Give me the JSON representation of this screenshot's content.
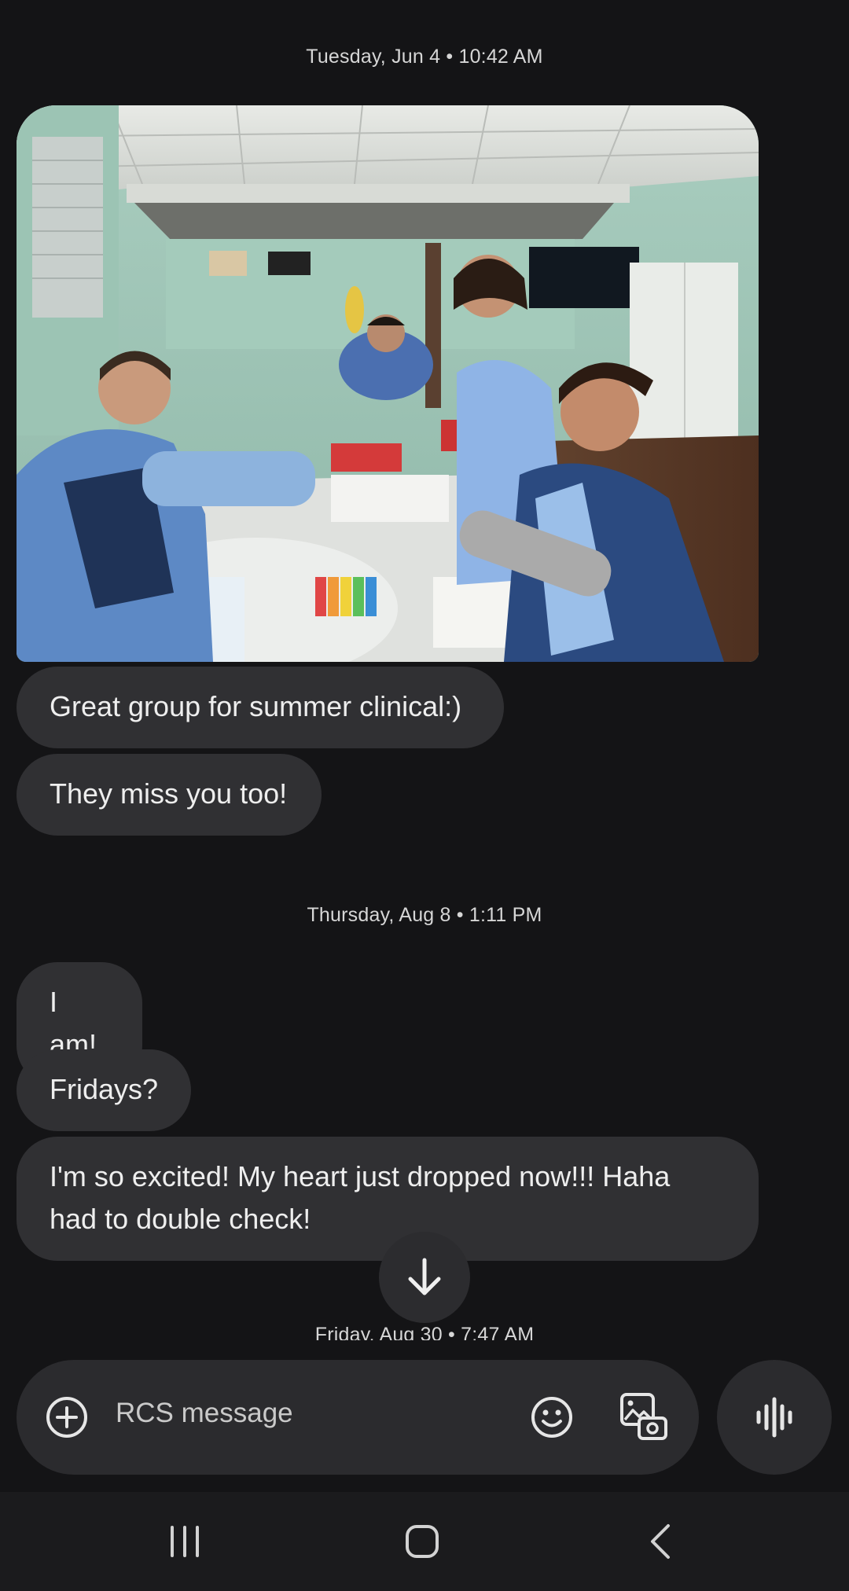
{
  "conversation": {
    "timestamps": [
      "Tuesday, Jun 4 • 10:42 AM",
      "Thursday, Aug 8 • 1:11 PM",
      "Friday, Aug 30 • 7:47 AM"
    ],
    "photo_label": "Clinical group photo",
    "messages": [
      "Great group for summer clinical:)",
      "They miss you too!",
      "I am!",
      "Fridays?",
      "I'm so excited! My heart just dropped now!!! Haha had to double check!"
    ]
  },
  "composer": {
    "placeholder": "RCS message",
    "add_icon": "plus-circle-icon",
    "emoji_icon": "smiley-icon",
    "gallery_icon": "gallery-camera-icon",
    "voice_icon": "voice-wave-icon"
  },
  "scroll_icon": "arrow-down-icon",
  "navigation": {
    "icons": [
      "recent-apps-icon",
      "home-icon",
      "back-icon"
    ]
  },
  "colors": {
    "background": "#141416",
    "bubble": "#303033",
    "composer": "#2b2b2e",
    "navbar": "#1b1b1d",
    "text": "#eeeeee"
  }
}
